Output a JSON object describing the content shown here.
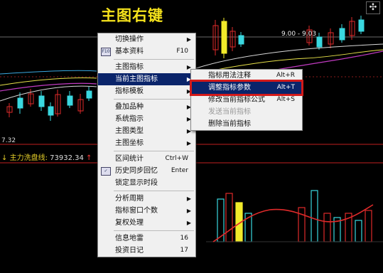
{
  "annotation_title": "主图右键",
  "top_icon": "✣",
  "price_labels": {
    "top_right": "9.00 - 9.03",
    "left": "7.32"
  },
  "indicator": {
    "arrow": "↓",
    "name": "主力洗盘线:",
    "value": "73932.34",
    "marker": "↑"
  },
  "context_menu": {
    "items": [
      {
        "label": "切换操作",
        "shortcut": "",
        "submenu": true
      },
      {
        "label": "基本资料",
        "shortcut": "F10",
        "submenu": false,
        "icon": "F10"
      },
      {
        "sep": true
      },
      {
        "label": "主图指标",
        "shortcut": "",
        "submenu": true
      },
      {
        "label": "当前主图指标",
        "shortcut": "",
        "submenu": true,
        "highlight": true
      },
      {
        "label": "指标模板",
        "shortcut": "",
        "submenu": true
      },
      {
        "sep": true
      },
      {
        "label": "叠加品种",
        "shortcut": "",
        "submenu": true
      },
      {
        "label": "系统指示",
        "shortcut": "",
        "submenu": true
      },
      {
        "label": "主图类型",
        "shortcut": "",
        "submenu": true
      },
      {
        "label": "主图坐标",
        "shortcut": "",
        "submenu": true
      },
      {
        "sep": true
      },
      {
        "label": "区间统计",
        "shortcut": "Ctrl+W",
        "submenu": false
      },
      {
        "label": "历史同步回忆",
        "shortcut": "Enter",
        "submenu": false,
        "icon": "✓"
      },
      {
        "label": "锁定显示时段",
        "shortcut": "",
        "submenu": false
      },
      {
        "sep": true
      },
      {
        "label": "分析周期",
        "shortcut": "",
        "submenu": true
      },
      {
        "label": "指标窗口个数",
        "shortcut": "",
        "submenu": true
      },
      {
        "label": "复权处理",
        "shortcut": "",
        "submenu": true
      },
      {
        "sep": true
      },
      {
        "label": "信息地雷",
        "shortcut": "16",
        "submenu": false
      },
      {
        "label": "投资日记",
        "shortcut": "17",
        "submenu": false
      }
    ]
  },
  "submenu": {
    "items": [
      {
        "label": "指标用法注释",
        "shortcut": "Alt+R",
        "disabled": false
      },
      {
        "label": "调整指标参数",
        "shortcut": "Alt+T",
        "disabled": false,
        "highlight": true
      },
      {
        "label": "修改当前指标公式",
        "shortcut": "Alt+S",
        "disabled": false
      },
      {
        "label": "发送当前指标",
        "shortcut": "",
        "disabled": true
      },
      {
        "label": "删除当前指标",
        "shortcut": "",
        "disabled": false
      }
    ]
  },
  "colors": {
    "highlight": "#0a246a",
    "callout_box": "#d21a1a",
    "title": "#f5e21c"
  }
}
